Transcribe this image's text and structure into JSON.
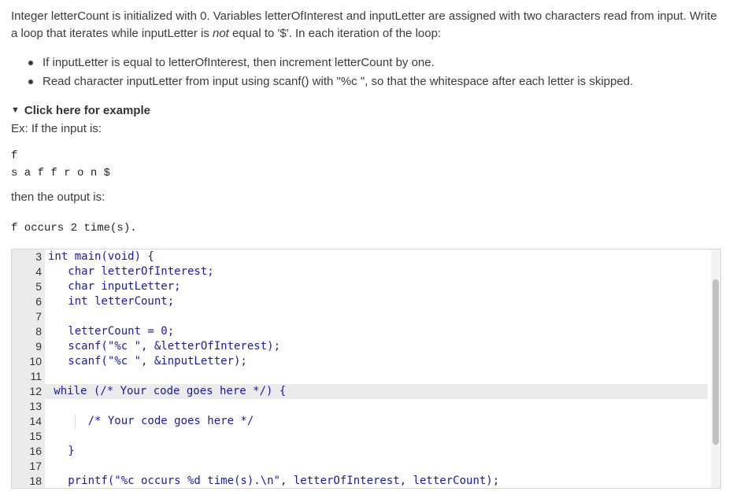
{
  "prompt": {
    "paragraph_part1": "Integer letterCount is initialized with 0. Variables letterOfInterest and inputLetter are assigned with two characters read from input. Write a loop that iterates while inputLetter is ",
    "paragraph_em": "not",
    "paragraph_part2": " equal to '$'. In each iteration of the loop:",
    "bullets": [
      "If inputLetter is equal to letterOfInterest, then increment letterCount by one.",
      "Read character inputLetter from input using scanf() with \"%c \", so that the whitespace after each letter is skipped."
    ]
  },
  "example": {
    "toggle_label": "Click here for example",
    "intro": "Ex: If the input is:",
    "input_line1": "f",
    "input_line2": "s a f f r o n $",
    "output_intro": "then the output is:",
    "output_line": "f occurs 2 time(s)."
  },
  "editor": {
    "line_numbers": [
      "3",
      "4",
      "5",
      "6",
      "7",
      "8",
      "9",
      "10",
      "11",
      "12",
      "13",
      "14",
      "15",
      "16",
      "17",
      "18"
    ],
    "lines": [
      "int main(void) {",
      "   char letterOfInterest;",
      "   char inputLetter;",
      "   int letterCount;",
      "",
      "   letterCount = 0;",
      "   scanf(\"%c \", &letterOfInterest);",
      "   scanf(\"%c \", &inputLetter);",
      "",
      "   while (/* Your code goes here */) {",
      "",
      "      /* Your code goes here */",
      "",
      "   }",
      "",
      "   printf(\"%c occurs %d time(s).\\n\", letterOfInterest, letterCount);"
    ]
  }
}
